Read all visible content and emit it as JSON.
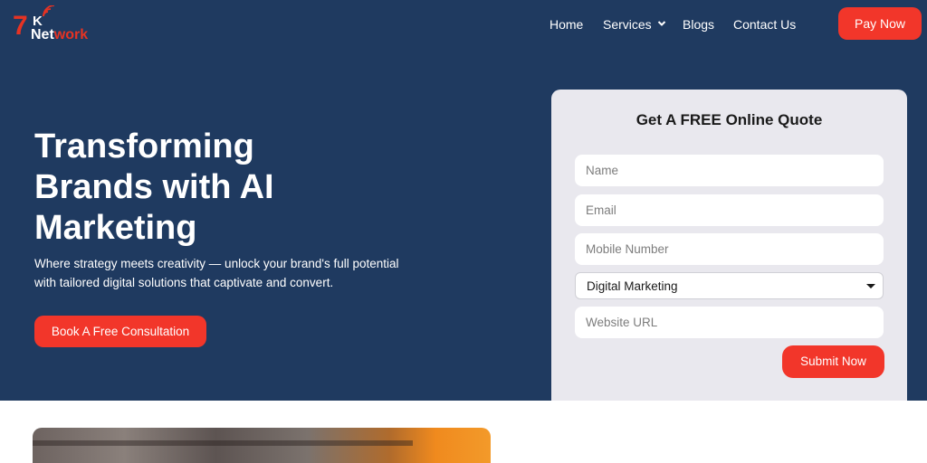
{
  "brand": {
    "logo_seven": "7",
    "logo_k": "K",
    "logo_network": "Net",
    "logo_network_accent": "work",
    "accent_color": "#f2362a",
    "hero_bg": "#1f3a60"
  },
  "nav": {
    "home": "Home",
    "services": "Services",
    "blogs": "Blogs",
    "contact": "Contact Us",
    "pay_now": "Pay Now"
  },
  "hero": {
    "title": "Transforming Brands with AI Marketing",
    "subtitle": "Where strategy meets creativity — unlock your brand's full potential with tailored digital solutions that captivate and convert.",
    "cta": "Book A Free Consultation"
  },
  "quote_form": {
    "title": "Get A FREE Online Quote",
    "name_placeholder": "Name",
    "email_placeholder": "Email",
    "mobile_placeholder": "Mobile Number",
    "service_selected": "Digital Marketing",
    "website_placeholder": "Website URL",
    "submit": "Submit Now"
  }
}
